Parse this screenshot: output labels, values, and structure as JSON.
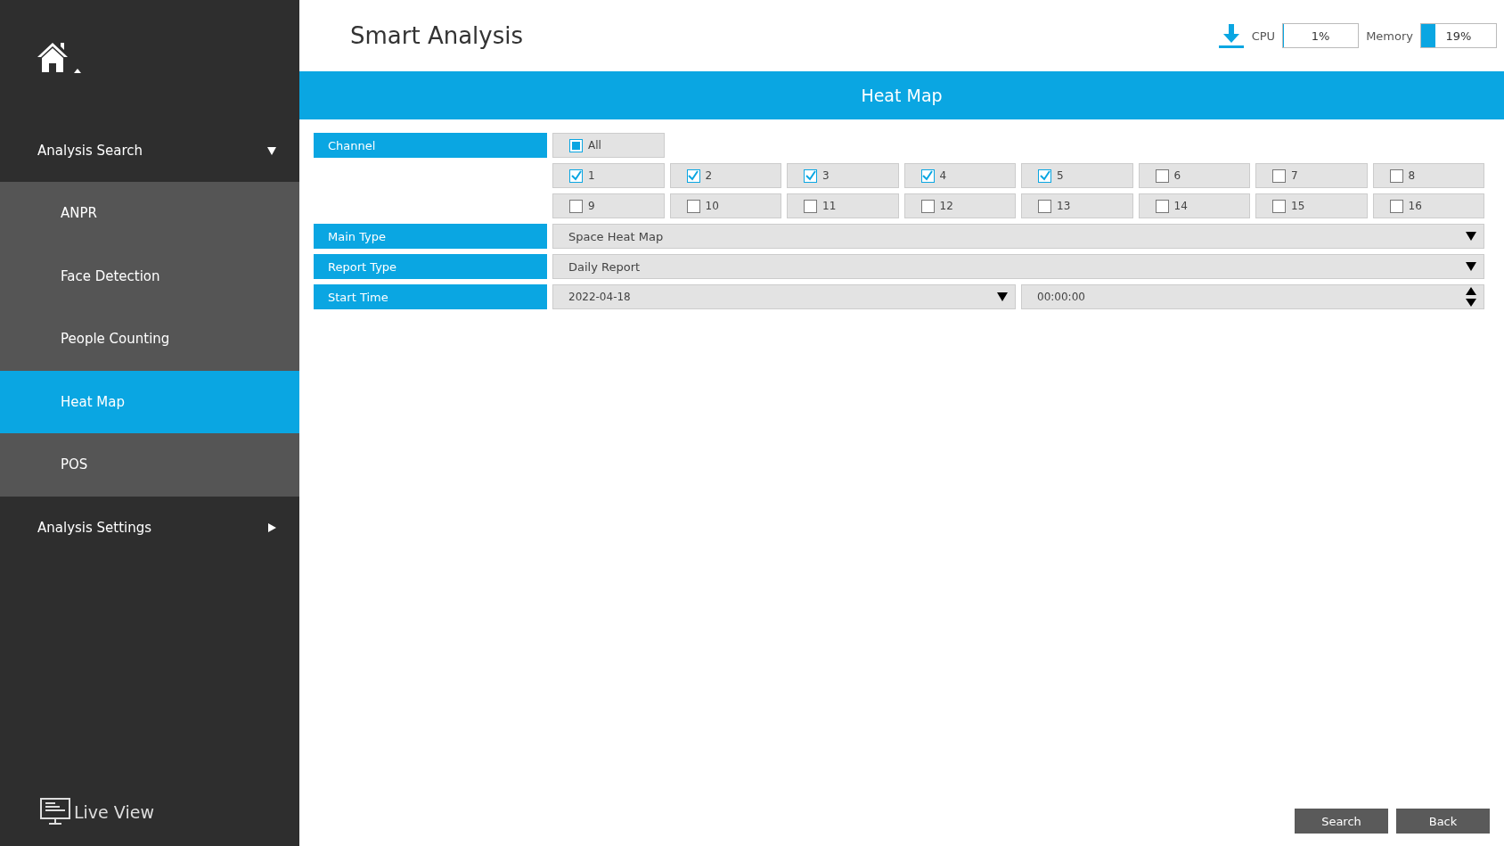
{
  "sidebar": {
    "groups": [
      {
        "label": "Analysis Search",
        "expanded": true,
        "items": [
          {
            "label": "ANPR",
            "selected": false
          },
          {
            "label": "Face Detection",
            "selected": false
          },
          {
            "label": "People Counting",
            "selected": false
          },
          {
            "label": "Heat Map",
            "selected": true
          },
          {
            "label": "POS",
            "selected": false
          }
        ]
      },
      {
        "label": "Analysis Settings",
        "expanded": false
      }
    ],
    "footer": {
      "label": "Live View"
    }
  },
  "header": {
    "title": "Smart Analysis",
    "cpu": {
      "label": "CPU",
      "reading": "1%",
      "level": 0.01
    },
    "memory": {
      "label": "Memory",
      "reading": "19%",
      "level": 0.19
    }
  },
  "panel": {
    "title": "Heat Map",
    "channel": {
      "label": "Channel",
      "all": {
        "label": "All",
        "indeterminate": true
      },
      "channels": [
        {
          "label": "1",
          "checked": true
        },
        {
          "label": "2",
          "checked": true
        },
        {
          "label": "3",
          "checked": true
        },
        {
          "label": "4",
          "checked": true
        },
        {
          "label": "5",
          "checked": true
        },
        {
          "label": "6",
          "checked": false
        },
        {
          "label": "7",
          "checked": false
        },
        {
          "label": "8",
          "checked": false
        },
        {
          "label": "9",
          "checked": false
        },
        {
          "label": "10",
          "checked": false
        },
        {
          "label": "11",
          "checked": false
        },
        {
          "label": "12",
          "checked": false
        },
        {
          "label": "13",
          "checked": false
        },
        {
          "label": "14",
          "checked": false
        },
        {
          "label": "15",
          "checked": false
        },
        {
          "label": "16",
          "checked": false
        }
      ]
    },
    "main_type": {
      "label": "Main Type",
      "value": "Space Heat Map"
    },
    "report_type": {
      "label": "Report Type",
      "value": "Daily Report"
    },
    "start_time": {
      "label": "Start Time",
      "date": "2022-04-18",
      "time": "00:00:00"
    }
  },
  "buttons": [
    "Search",
    "Back"
  ]
}
